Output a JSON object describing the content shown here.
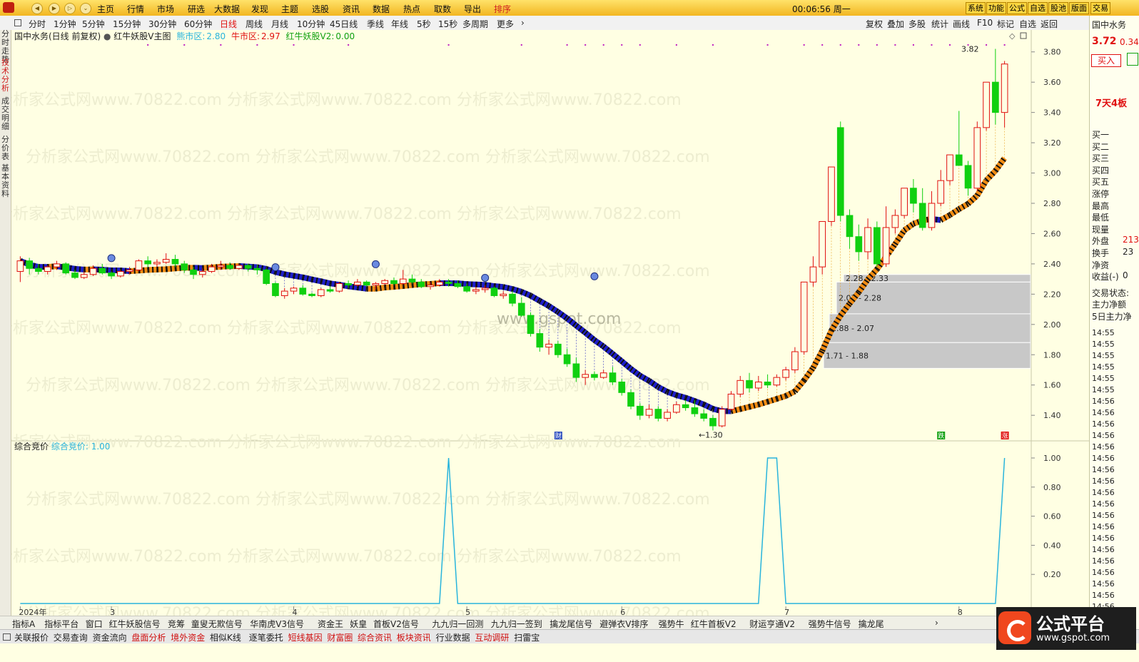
{
  "menu": {
    "items": [
      "主页",
      "行情",
      "市场",
      "研选",
      "大数据",
      "发现",
      "主题",
      "选股",
      "资讯",
      "数据",
      "热点",
      "取数",
      "导出",
      "排序"
    ],
    "clock": "00:06:56 周一",
    "right_buttons": [
      "系统",
      "功能",
      "公式",
      "自选",
      "股池",
      "版面",
      "交易"
    ]
  },
  "toolbar": {
    "periods": [
      "分时",
      "1分钟",
      "5分钟",
      "15分钟",
      "30分钟",
      "60分钟",
      "日线",
      "周线",
      "月线",
      "10分钟",
      "45日线",
      "季线",
      "年线",
      "5秒",
      "15秒",
      "多周期",
      "更多"
    ],
    "active_period": "日线",
    "tools": [
      "复权",
      "叠加",
      "多股",
      "统计",
      "画线",
      "F10",
      "标记",
      "自选",
      "返回"
    ]
  },
  "sidetabs": [
    "分时走势",
    "技术分析",
    "成交明细",
    "分价表",
    "基本资料"
  ],
  "chart_header": {
    "stock": "国中水务(日线 前复权)",
    "indicator": "红牛妖股V主图",
    "bear_label": "熊市区:",
    "bear_value": "2.80",
    "bull_label": "牛市区:",
    "bull_value": "2.97",
    "v2_label": "红牛妖股V2:",
    "v2_value": "0.00"
  },
  "sub_header": {
    "name": "综合竞价",
    "label": "综合竞价:",
    "value": "1.00"
  },
  "main_axis": [
    "3.80",
    "3.60",
    "3.40",
    "3.20",
    "3.00",
    "2.80",
    "2.60",
    "2.40",
    "2.20",
    "2.00",
    "1.80",
    "1.60",
    "1.40"
  ],
  "sub_axis": [
    "1.00",
    "0.80",
    "0.60",
    "0.40",
    "0.20"
  ],
  "x_labels": [
    "2024年",
    "3",
    "4",
    "5",
    "6",
    "7",
    "8"
  ],
  "annotations": {
    "high": "3.82",
    "low": "1.30",
    "zones": [
      "2.28 - 2.33",
      "2.07 - 2.28",
      "1.88 - 2.07",
      "1.71 - 1.88"
    ],
    "markers": [
      "财",
      "跌",
      "涨"
    ],
    "watermark_center": "www.gspot.com",
    "watermark_rows": "分析家公式网www.70822.com"
  },
  "right_panel": {
    "stock_name": "国中水务",
    "price": "3.72",
    "change": "0.34",
    "buy_button": "买入",
    "streak": "7天4板",
    "labels": [
      "买一",
      "买二",
      "买三",
      "买四",
      "买五",
      "涨停",
      "最高",
      "最低",
      "现量",
      "外盘",
      "换手",
      "净资",
      "收益(-)",
      "交易状态:",
      "主力净额",
      "5日主力净"
    ],
    "values": [
      "",
      "",
      "",
      "",
      "",
      "",
      "",
      "",
      "",
      "213",
      "23",
      "",
      "0",
      "",
      "",
      ""
    ],
    "times": [
      "14:55",
      "14:55",
      "14:55",
      "14:55",
      "14:55",
      "14:55",
      "14:56",
      "14:56",
      "14:56",
      "14:56",
      "14:56",
      "14:56",
      "14:56",
      "14:56",
      "14:56",
      "14:56",
      "14:56",
      "14:56",
      "14:56",
      "14:56",
      "14:56",
      "14:56",
      "14:56",
      "14:56",
      "14:56"
    ]
  },
  "bottom_tabs": [
    "指标A",
    "指标平台",
    "窗口",
    "红牛妖股信号",
    "竞筹",
    "童叟无欺信号",
    "华南虎V3信号",
    "资金王",
    "妖皇",
    "首板V2信号",
    "九九归一回测",
    "九九归一签到",
    "擒龙尾信号",
    "避弹衣V排序",
    "强势牛",
    "红牛首板V2",
    "财运亨通V2",
    "强势牛信号",
    "擒龙尾"
  ],
  "status_items": [
    "关联报价",
    "交易查询",
    "资金流向",
    "盘面分析",
    "境外资金",
    "相似K线",
    "逐笔委托",
    "短线基因",
    "财富圈",
    "综合资讯",
    "板块资讯",
    "行业数据",
    "互动调研",
    "扫雷宝"
  ],
  "logo": {
    "title": "公式平台",
    "url": "www.gspot.com"
  },
  "colors": {
    "up": "#E01010",
    "down": "#10D010",
    "bear_band": "#1E1EC8",
    "bull_band": "#F08C14",
    "zone": "#C8C8C8",
    "sub_line": "#28B4DC"
  },
  "chart_data": {
    "type": "candlestick",
    "title": "国中水务(日线 前复权)",
    "ylim": [
      1.25,
      3.86
    ],
    "candles": [
      [
        2.35,
        2.45,
        2.28,
        2.42
      ],
      [
        2.42,
        2.44,
        2.33,
        2.37
      ],
      [
        2.37,
        2.4,
        2.33,
        2.35
      ],
      [
        2.35,
        2.39,
        2.33,
        2.38
      ],
      [
        2.38,
        2.42,
        2.36,
        2.4
      ],
      [
        2.4,
        2.41,
        2.33,
        2.34
      ],
      [
        2.34,
        2.36,
        2.3,
        2.31
      ],
      [
        2.31,
        2.35,
        2.3,
        2.33
      ],
      [
        2.33,
        2.39,
        2.32,
        2.37
      ],
      [
        2.37,
        2.4,
        2.33,
        2.34
      ],
      [
        2.34,
        2.35,
        2.3,
        2.32
      ],
      [
        2.32,
        2.36,
        2.31,
        2.35
      ],
      [
        2.35,
        2.38,
        2.33,
        2.36
      ],
      [
        2.36,
        2.43,
        2.35,
        2.42
      ],
      [
        2.42,
        2.45,
        2.38,
        2.4
      ],
      [
        2.4,
        2.43,
        2.38,
        2.41
      ],
      [
        2.41,
        2.47,
        2.4,
        2.43
      ],
      [
        2.43,
        2.46,
        2.38,
        2.4
      ],
      [
        2.4,
        2.42,
        2.34,
        2.36
      ],
      [
        2.36,
        2.38,
        2.3,
        2.33
      ],
      [
        2.33,
        2.37,
        2.31,
        2.35
      ],
      [
        2.35,
        2.4,
        2.34,
        2.38
      ],
      [
        2.38,
        2.42,
        2.36,
        2.39
      ],
      [
        2.39,
        2.41,
        2.36,
        2.37
      ],
      [
        2.37,
        2.4,
        2.36,
        2.39
      ],
      [
        2.39,
        2.4,
        2.35,
        2.37
      ],
      [
        2.37,
        2.39,
        2.33,
        2.36
      ],
      [
        2.36,
        2.37,
        2.26,
        2.27
      ],
      [
        2.27,
        2.28,
        2.18,
        2.19
      ],
      [
        2.19,
        2.24,
        2.17,
        2.22
      ],
      [
        2.22,
        2.25,
        2.2,
        2.24
      ],
      [
        2.24,
        2.26,
        2.19,
        2.2
      ],
      [
        2.2,
        2.21,
        2.18,
        2.19
      ],
      [
        2.19,
        2.24,
        2.18,
        2.23
      ],
      [
        2.23,
        2.25,
        2.21,
        2.22
      ],
      [
        2.22,
        2.28,
        2.21,
        2.27
      ],
      [
        2.27,
        2.29,
        2.24,
        2.26
      ],
      [
        2.26,
        2.3,
        2.25,
        2.28
      ],
      [
        2.28,
        2.29,
        2.25,
        2.26
      ],
      [
        2.26,
        2.28,
        2.23,
        2.27
      ],
      [
        2.27,
        2.3,
        2.26,
        2.29
      ],
      [
        2.29,
        2.31,
        2.26,
        2.27
      ],
      [
        2.27,
        2.36,
        2.26,
        2.3
      ],
      [
        2.3,
        2.33,
        2.27,
        2.28
      ],
      [
        2.28,
        2.3,
        2.24,
        2.25
      ],
      [
        2.25,
        2.28,
        2.23,
        2.26
      ],
      [
        2.26,
        2.3,
        2.25,
        2.28
      ],
      [
        2.28,
        2.3,
        2.25,
        2.27
      ],
      [
        2.27,
        2.29,
        2.24,
        2.25
      ],
      [
        2.25,
        2.27,
        2.21,
        2.22
      ],
      [
        2.22,
        2.25,
        2.2,
        2.23
      ],
      [
        2.23,
        2.26,
        2.21,
        2.24
      ],
      [
        2.24,
        2.25,
        2.18,
        2.19
      ],
      [
        2.19,
        2.22,
        2.17,
        2.2
      ],
      [
        2.2,
        2.22,
        2.12,
        2.14
      ],
      [
        2.14,
        2.18,
        2.05,
        2.06
      ],
      [
        2.06,
        2.08,
        1.92,
        1.94
      ],
      [
        1.94,
        1.97,
        1.82,
        1.85
      ],
      [
        1.85,
        1.9,
        1.8,
        1.87
      ],
      [
        1.87,
        1.89,
        1.78,
        1.8
      ],
      [
        1.8,
        1.84,
        1.72,
        1.74
      ],
      [
        1.74,
        1.78,
        1.62,
        1.65
      ],
      [
        1.65,
        1.7,
        1.6,
        1.67
      ],
      [
        1.67,
        1.69,
        1.63,
        1.65
      ],
      [
        1.65,
        1.7,
        1.64,
        1.68
      ],
      [
        1.68,
        1.72,
        1.6,
        1.62
      ],
      [
        1.62,
        1.64,
        1.53,
        1.55
      ],
      [
        1.55,
        1.57,
        1.44,
        1.46
      ],
      [
        1.46,
        1.48,
        1.37,
        1.4
      ],
      [
        1.4,
        1.47,
        1.38,
        1.44
      ],
      [
        1.44,
        1.46,
        1.36,
        1.38
      ],
      [
        1.38,
        1.44,
        1.36,
        1.42
      ],
      [
        1.42,
        1.49,
        1.41,
        1.47
      ],
      [
        1.47,
        1.5,
        1.43,
        1.45
      ],
      [
        1.45,
        1.5,
        1.39,
        1.41
      ],
      [
        1.41,
        1.44,
        1.36,
        1.38
      ],
      [
        1.38,
        1.4,
        1.3,
        1.33
      ],
      [
        1.33,
        1.46,
        1.32,
        1.44
      ],
      [
        1.44,
        1.56,
        1.43,
        1.54
      ],
      [
        1.54,
        1.66,
        1.52,
        1.63
      ],
      [
        1.63,
        1.68,
        1.55,
        1.58
      ],
      [
        1.58,
        1.66,
        1.56,
        1.62
      ],
      [
        1.62,
        1.67,
        1.58,
        1.6
      ],
      [
        1.6,
        1.67,
        1.59,
        1.65
      ],
      [
        1.65,
        1.72,
        1.63,
        1.7
      ],
      [
        1.7,
        1.85,
        1.68,
        1.82
      ],
      [
        1.82,
        2.2,
        1.8,
        2.28
      ],
      [
        2.28,
        2.45,
        2.25,
        2.38
      ],
      [
        2.38,
        2.68,
        2.33,
        2.68
      ],
      [
        2.68,
        3.04,
        2.65,
        3.04
      ],
      [
        3.3,
        3.34,
        2.68,
        2.72
      ],
      [
        2.72,
        2.76,
        2.5,
        2.58
      ],
      [
        2.58,
        2.66,
        2.42,
        2.48
      ],
      [
        2.48,
        2.7,
        2.43,
        2.64
      ],
      [
        2.64,
        2.68,
        2.38,
        2.4
      ],
      [
        2.4,
        2.78,
        2.38,
        2.64
      ],
      [
        2.64,
        2.76,
        2.6,
        2.72
      ],
      [
        2.72,
        2.9,
        2.7,
        2.9
      ],
      [
        2.9,
        2.96,
        2.74,
        2.8
      ],
      [
        2.8,
        2.9,
        2.62,
        2.64
      ],
      [
        2.64,
        2.88,
        2.62,
        2.8
      ],
      [
        2.8,
        3.02,
        2.78,
        2.95
      ],
      [
        2.95,
        3.12,
        2.92,
        3.12
      ],
      [
        3.12,
        3.41,
        3.05,
        3.05
      ],
      [
        3.05,
        3.08,
        2.85,
        2.9
      ],
      [
        2.9,
        3.34,
        2.88,
        3.3
      ],
      [
        3.3,
        3.55,
        3.28,
        3.6
      ],
      [
        3.6,
        3.82,
        3.32,
        3.4
      ],
      [
        3.4,
        3.74,
        3.3,
        3.72
      ]
    ],
    "sub_series": {
      "name": "综合竞价",
      "spikes_at": [
        47,
        82,
        108,
        109
      ],
      "ylim": [
        0,
        1.0
      ]
    }
  }
}
